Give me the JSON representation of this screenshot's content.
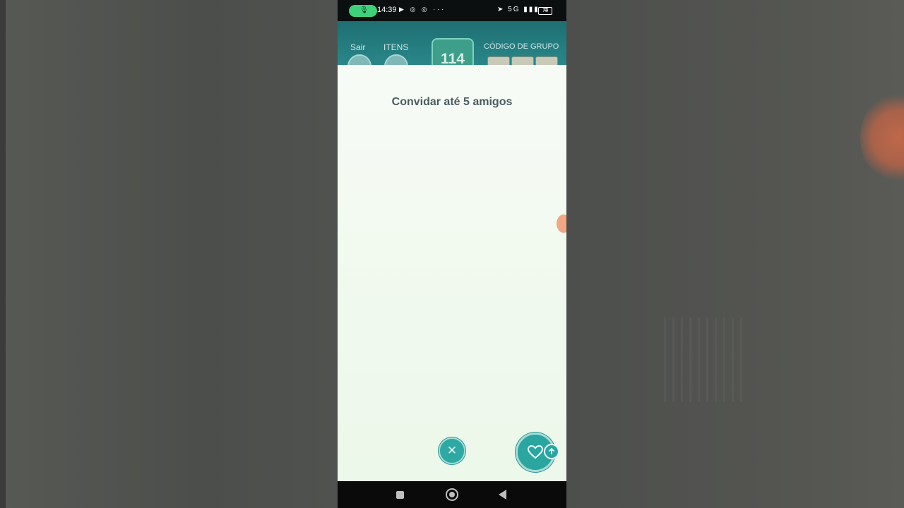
{
  "status_bar": {
    "time": "14:39",
    "mic_icon": "microphone-icon",
    "left_icons": "▶ ◎ ◎ ···",
    "right_icons": "➤ 5G ▮▮▮ ≋",
    "battery": "73"
  },
  "game_header": {
    "exit_label": "Sair",
    "items_label": "ITENS",
    "player_count": "114",
    "group_code_label": "CÓDIGO DE GRUPO"
  },
  "modal": {
    "title": "Convidar até 5 amigos",
    "close_icon": "close-icon",
    "invite_icon": "heart-icon",
    "badge_icon": "arrow-up-icon"
  },
  "nav_bar": {
    "recent_icon": "square-icon",
    "home_icon": "home-circle-icon",
    "back_icon": "back-triangle-icon"
  },
  "colors": {
    "accent": "#2aa59f",
    "header": "#2b8a8c",
    "modal_bg": "#f0f9ee",
    "title_text": "#4c5b60"
  }
}
